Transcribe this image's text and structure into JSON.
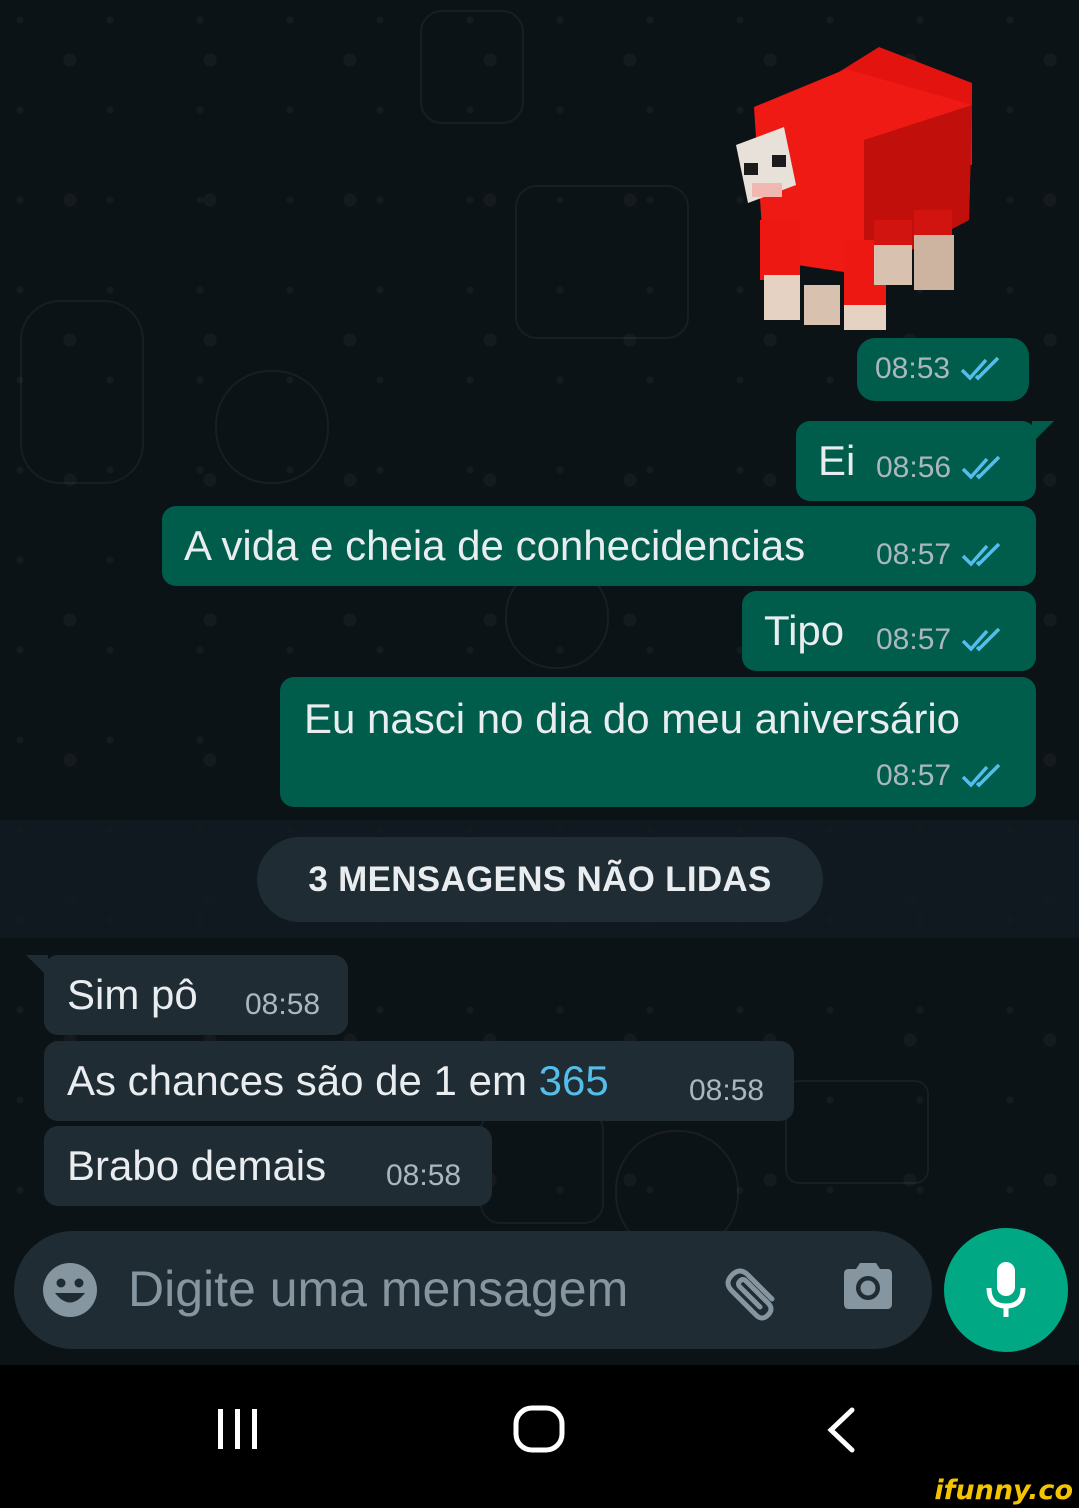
{
  "conversation": {
    "outgoing": [
      {
        "text": "",
        "time": "08:53",
        "type": "sticker",
        "sticker": "red-minecraft-sheep"
      },
      {
        "text": "Ei",
        "time": "08:56"
      },
      {
        "text": "A vida e cheia de conhecidencias",
        "time": "08:57"
      },
      {
        "text": "Tipo",
        "time": "08:57"
      },
      {
        "text": "Eu nasci no dia do meu aniversário",
        "time": "08:57"
      }
    ],
    "unread_label": "3 MENSAGENS NÃO LIDAS",
    "incoming": [
      {
        "text": "Sim pô",
        "time": "08:58"
      },
      {
        "text_before": "As chances são de 1 em ",
        "link": "365",
        "time": "08:58"
      },
      {
        "text": "Brabo demais",
        "time": "08:58"
      }
    ]
  },
  "composer": {
    "placeholder": "Digite uma mensagem",
    "icons": [
      "emoji-icon",
      "attach-icon",
      "camera-icon",
      "mic-icon"
    ]
  },
  "navbar": {
    "icons": [
      "recent-apps-icon",
      "home-icon",
      "back-icon"
    ]
  },
  "watermark": "ifunny.co",
  "colors": {
    "outgoing_bubble": "#005c4b",
    "incoming_bubble": "#1f2c33",
    "read_ticks": "#53bdeb",
    "accent": "#00a884",
    "background": "#0c1317"
  }
}
